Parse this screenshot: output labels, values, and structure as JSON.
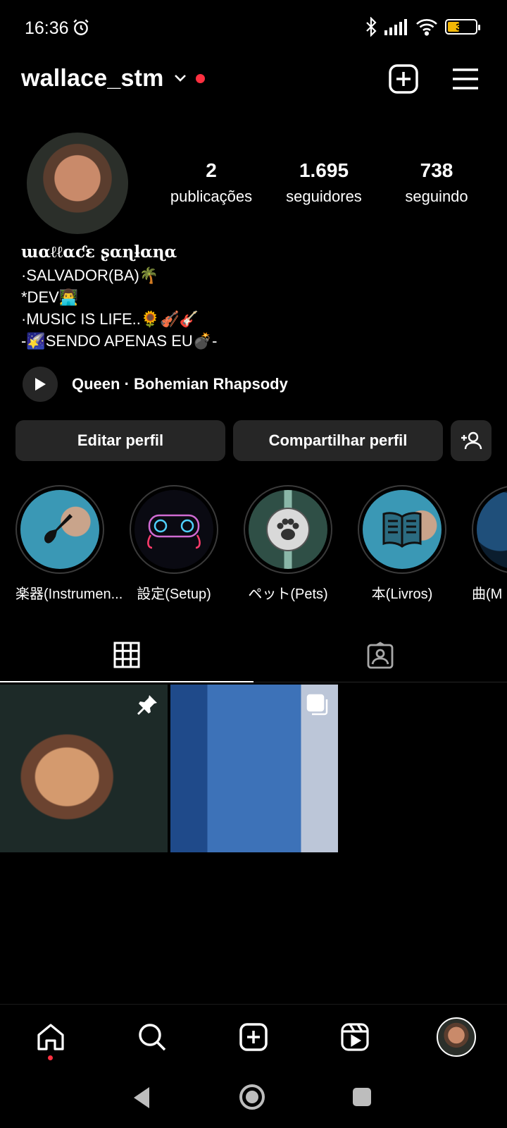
{
  "status_bar": {
    "time": "16:36",
    "battery": "38"
  },
  "header": {
    "username": "wallace_stm"
  },
  "profile": {
    "stats": [
      {
        "value": "2",
        "label": "publicações"
      },
      {
        "value": "1.695",
        "label": "seguidores"
      },
      {
        "value": "738",
        "label": "seguindo"
      }
    ],
    "display_name": "ɯαℓℓαƈε ʂαɳƚαɳα",
    "bio_lines": [
      "·SALVADOR(BA)🌴",
      "*DEV👨‍💻",
      "·MUSIC IS LIFE..🌻🎻🎸",
      "-🌠SENDO APENAS EU💣-"
    ],
    "music": "Queen · Bohemian Rhapsody"
  },
  "actions": {
    "edit_label": "Editar perfil",
    "share_label": "Compartilhar perfil"
  },
  "highlights": [
    {
      "label": "楽器(Instrumen..."
    },
    {
      "label": "設定(Setup)"
    },
    {
      "label": "ペット(Pets)"
    },
    {
      "label": "本(Livros)"
    },
    {
      "label": "曲(M"
    }
  ]
}
